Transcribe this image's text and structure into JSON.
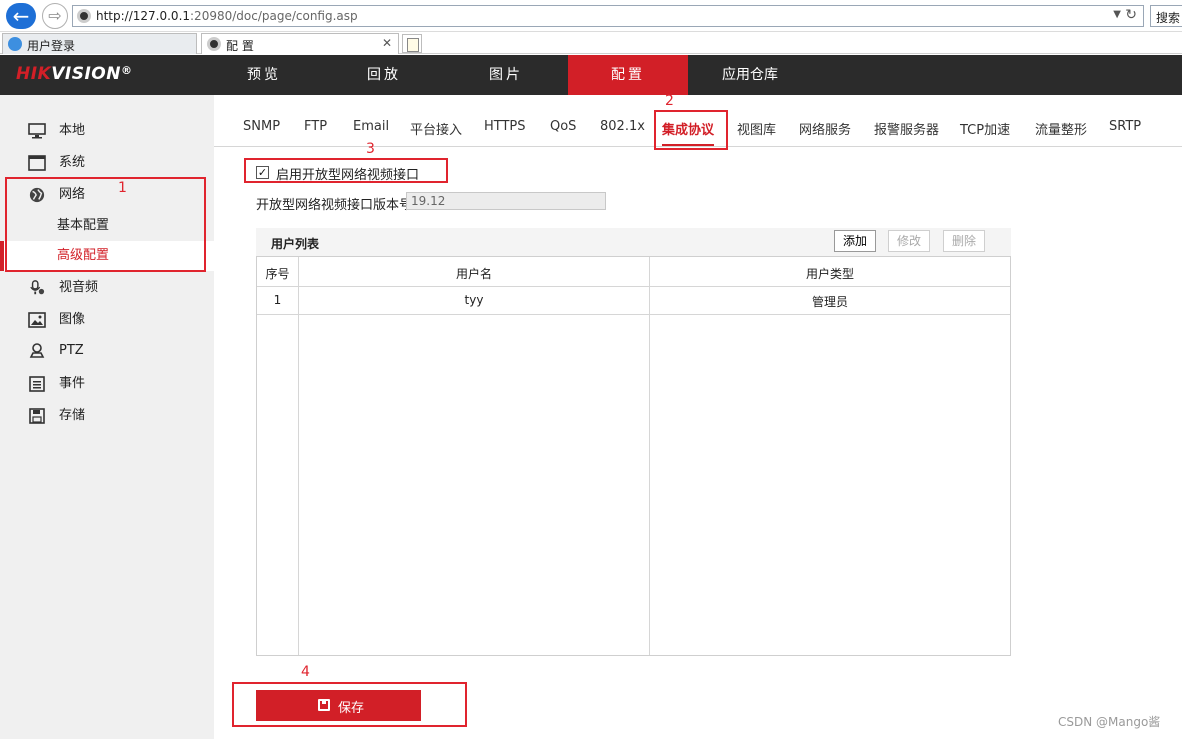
{
  "browser": {
    "url_host": "http://127.0.0.1",
    "url_rest": ":20980/doc/page/config.asp",
    "search_label": "搜索",
    "tabs": [
      {
        "label": "用户登录"
      },
      {
        "label": "配 置"
      }
    ]
  },
  "header": {
    "logo_red": "HIK",
    "logo_white": "VISION",
    "logo_reg": "®",
    "nav": [
      "预览",
      "回放",
      "图片",
      "配置",
      "应用仓库"
    ],
    "active_nav": "配置"
  },
  "sidebar": {
    "items": [
      {
        "label": "本地",
        "icon": "monitor-icon"
      },
      {
        "label": "系统",
        "icon": "window-icon"
      },
      {
        "label": "网络",
        "icon": "globe-icon"
      },
      {
        "label": "基本配置",
        "sub": true
      },
      {
        "label": "高级配置",
        "sub": true,
        "active": true
      },
      {
        "label": "视音频",
        "icon": "microphone-icon"
      },
      {
        "label": "图像",
        "icon": "image-icon"
      },
      {
        "label": "PTZ",
        "icon": "ptz-icon"
      },
      {
        "label": "事件",
        "icon": "event-list-icon"
      },
      {
        "label": "存储",
        "icon": "storage-icon"
      }
    ]
  },
  "subtabs": [
    "SNMP",
    "FTP",
    "Email",
    "平台接入",
    "HTTPS",
    "QoS",
    "802.1x",
    "集成协议",
    "视图库",
    "网络服务",
    "报警服务器",
    "TCP加速",
    "流量整形",
    "SRTP"
  ],
  "active_subtab": "集成协议",
  "form": {
    "enable_checked": true,
    "enable_label": "启用开放型网络视频接口",
    "version_label": "开放型网络视频接口版本号",
    "version_value": "19.12"
  },
  "user_list": {
    "title": "用户列表",
    "add_label": "添加",
    "edit_label": "修改",
    "delete_label": "删除",
    "columns": [
      "序号",
      "用户名",
      "用户类型"
    ],
    "rows": [
      {
        "index": "1",
        "username": "tyy",
        "type": "管理员"
      }
    ]
  },
  "save_label": "保存",
  "annotations": [
    "1",
    "2",
    "3",
    "4"
  ],
  "watermark": "CSDN @Mango酱",
  "colors": {
    "accent": "#d21f27",
    "header_bg": "#2b2b2b",
    "sidebar_bg": "#f0f0f0"
  }
}
